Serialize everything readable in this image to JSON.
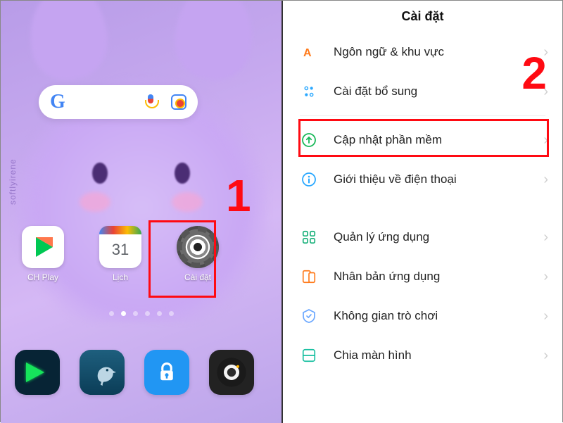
{
  "homescreen": {
    "watermark": "softlyirene",
    "search": {
      "placeholder": ""
    },
    "apps": [
      {
        "label": "CH Play"
      },
      {
        "label": "Lịch",
        "dayNumber": "31"
      },
      {
        "label": "Cài đặt"
      }
    ],
    "page_dots": {
      "count": 6,
      "active": 1
    }
  },
  "settings": {
    "title": "Cài đặt",
    "rows": [
      {
        "key": "language",
        "label": "Ngôn ngữ & khu vực"
      },
      {
        "key": "more",
        "label": "Cài đặt bổ sung"
      },
      {
        "key": "update",
        "label": "Cập nhật phần mềm"
      },
      {
        "key": "about",
        "label": "Giới thiệu về điện thoại"
      },
      {
        "key": "apps",
        "label": "Quản lý ứng dụng"
      },
      {
        "key": "clone",
        "label": "Nhân bản ứng dụng"
      },
      {
        "key": "game",
        "label": "Không gian trò chơi"
      },
      {
        "key": "split",
        "label": "Chia màn hình"
      }
    ]
  },
  "annotations": {
    "step1": "1",
    "step2": "2"
  }
}
